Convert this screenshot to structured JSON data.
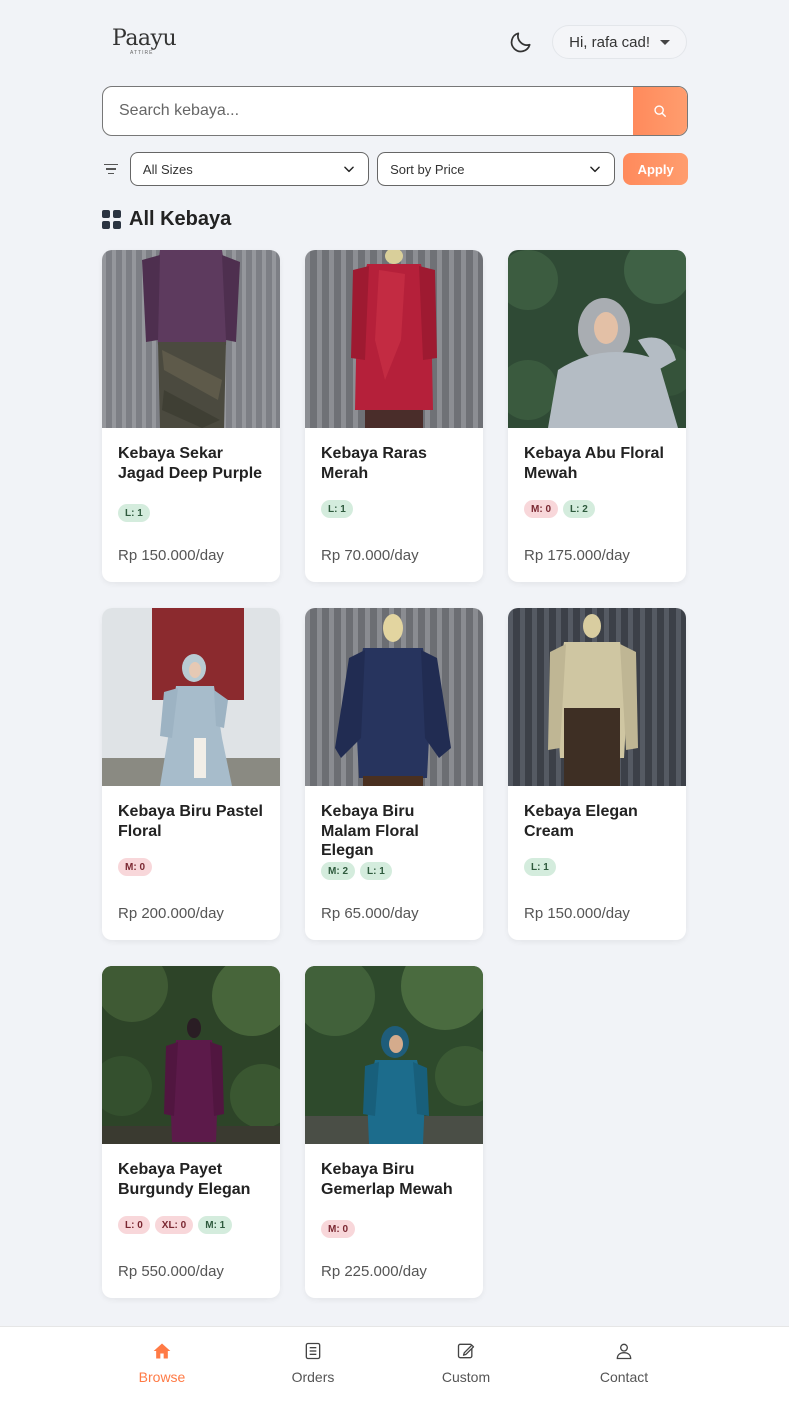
{
  "header": {
    "logo_text": "Paayu",
    "logo_sub": "ATTIRE",
    "greeting": "Hi, rafa cad!"
  },
  "search": {
    "placeholder": "Search kebaya..."
  },
  "filters": {
    "size_selected": "All Sizes",
    "sort_selected": "Sort by Price",
    "apply_label": "Apply"
  },
  "section": {
    "title": "All Kebaya"
  },
  "products": [
    {
      "name": "Kebaya Sekar Jagad Deep Purple",
      "price": "Rp 150.000/day",
      "badges": [
        {
          "label": "L: 1",
          "status": "ok"
        }
      ]
    },
    {
      "name": "Kebaya Raras Merah",
      "price": "Rp 70.000/day",
      "badges": [
        {
          "label": "L: 1",
          "status": "ok"
        }
      ]
    },
    {
      "name": "Kebaya Abu Floral Mewah",
      "price": "Rp 175.000/day",
      "badges": [
        {
          "label": "M: 0",
          "status": "out"
        },
        {
          "label": "L: 2",
          "status": "ok"
        }
      ]
    },
    {
      "name": "Kebaya Biru Pastel Floral",
      "price": "Rp 200.000/day",
      "badges": [
        {
          "label": "M: 0",
          "status": "out"
        }
      ]
    },
    {
      "name": "Kebaya Biru Malam Floral Elegan",
      "price": "Rp 65.000/day",
      "badges": [
        {
          "label": "M: 2",
          "status": "ok"
        },
        {
          "label": "L: 1",
          "status": "ok"
        }
      ]
    },
    {
      "name": "Kebaya Elegan Cream",
      "price": "Rp 150.000/day",
      "badges": [
        {
          "label": "L: 1",
          "status": "ok"
        }
      ]
    },
    {
      "name": "Kebaya Payet Burgundy Elegan",
      "price": "Rp 550.000/day",
      "badges": [
        {
          "label": "L: 0",
          "status": "out"
        },
        {
          "label": "XL: 0",
          "status": "out"
        },
        {
          "label": "M: 1",
          "status": "ok"
        }
      ]
    },
    {
      "name": "Kebaya Biru Gemerlap Mewah",
      "price": "Rp 225.000/day",
      "badges": [
        {
          "label": "M: 0",
          "status": "out"
        }
      ]
    }
  ],
  "nav": {
    "browse": "Browse",
    "orders": "Orders",
    "custom": "Custom",
    "contact": "Contact"
  },
  "colors": {
    "accent": "#ff7a45",
    "background": "#f1f3f7",
    "badge_ok": "#d4ecdd",
    "badge_out": "#f8d7da"
  }
}
